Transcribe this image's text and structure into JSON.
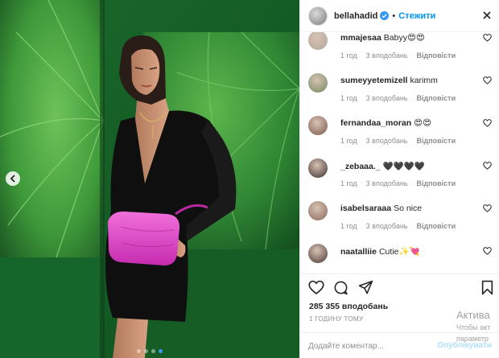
{
  "post": {
    "carousel": {
      "slide_count": 4,
      "active_index": 3
    }
  },
  "header": {
    "username": "bellahadid",
    "separator": "•",
    "follow_label": "Стежити"
  },
  "comments": [
    {
      "user": "mmajesaa",
      "text": "Babyy😍😍",
      "time": "1 год",
      "likes": "3 вподобань",
      "reply": "Відповісти"
    },
    {
      "user": "sumeyyetemizell",
      "text": "karimm",
      "time": "1 год",
      "likes": "3 вподобань",
      "reply": "Відповісти"
    },
    {
      "user": "fernandaa_moran",
      "text": "😍😍",
      "time": "1 год",
      "likes": "3 вподобань",
      "reply": "Відповісти"
    },
    {
      "user": "_zebaaa._",
      "text": "🖤🖤🖤🖤",
      "time": "1 год",
      "likes": "3 вподобань",
      "reply": "Відповісти"
    },
    {
      "user": "isabelsaraaa",
      "text": "So nice",
      "time": "1 год",
      "likes": "3 вподобань",
      "reply": "Відповісти"
    },
    {
      "user": "naatalliie",
      "text": "Cutie✨💘",
      "time": "",
      "likes": "",
      "reply": ""
    }
  ],
  "stats": {
    "likes": "285 355 вподобань",
    "time_ago": "1 ГОДИНУ ТОМУ"
  },
  "add_comment": {
    "placeholder": "Додайте коментар...",
    "publish_label": "Опублікувати"
  },
  "windows_watermark": {
    "title": "Актива",
    "line1": "Чтобы акт",
    "line2": "параметр"
  },
  "colors": {
    "accent": "#0095f6",
    "verified": "#3897f0",
    "background_green": "#1f6e2e",
    "bag_pink": "#e040c8"
  }
}
